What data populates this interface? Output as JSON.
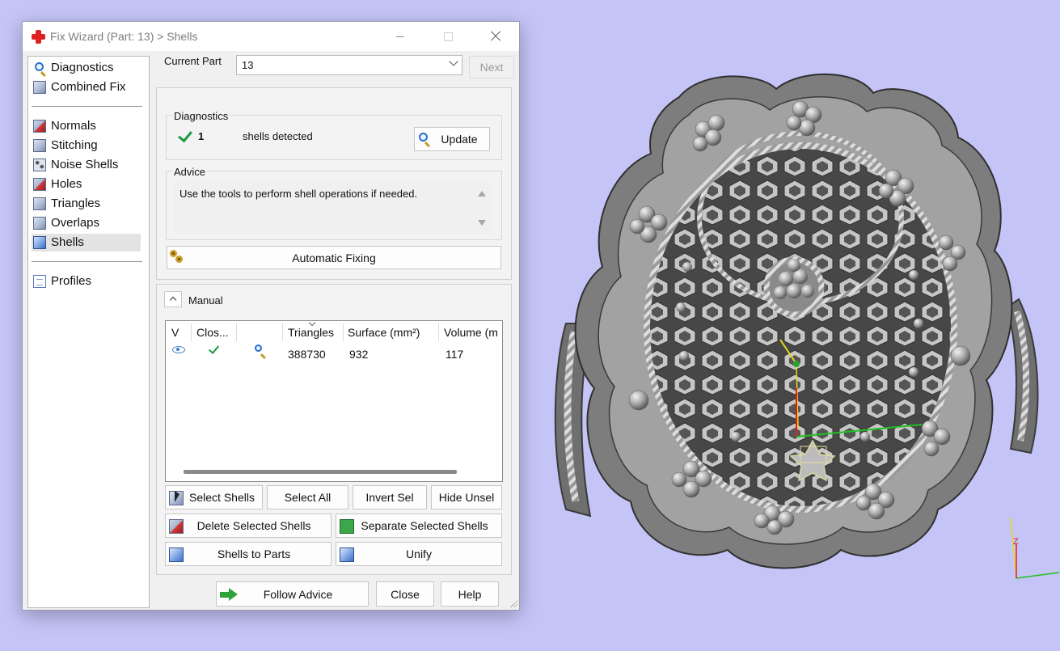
{
  "window": {
    "title": "Fix Wizard (Part: 13) > Shells"
  },
  "nav": {
    "items": [
      {
        "label": "Diagnostics",
        "icon": "magnifier-icon"
      },
      {
        "label": "Combined Fix",
        "icon": "cube-icon"
      },
      {
        "label": "Normals",
        "icon": "normals-icon"
      },
      {
        "label": "Stitching",
        "icon": "stitching-icon"
      },
      {
        "label": "Noise Shells",
        "icon": "noise-shells-icon"
      },
      {
        "label": "Holes",
        "icon": "holes-icon"
      },
      {
        "label": "Triangles",
        "icon": "triangles-icon"
      },
      {
        "label": "Overlaps",
        "icon": "overlaps-icon"
      },
      {
        "label": "Shells",
        "icon": "shells-icon"
      },
      {
        "label": "Profiles",
        "icon": "profiles-icon"
      }
    ],
    "selected": "Shells"
  },
  "part": {
    "label": "Current Part",
    "value": "13",
    "next_label": "Next"
  },
  "diagnostics": {
    "title": "Diagnostics",
    "count": "1",
    "text": "shells detected",
    "update_label": "Update"
  },
  "advice": {
    "title": "Advice",
    "text": "Use the tools to perform shell operations if needed."
  },
  "auto_fix_label": "Automatic Fixing",
  "manual": {
    "title": "Manual",
    "columns": [
      "V",
      "Clos...",
      "",
      "Triangles",
      "Surface (mm²)",
      "Volume (m"
    ],
    "rows": [
      {
        "triangles": "388730",
        "surface": "932",
        "volume": "117"
      }
    ]
  },
  "buttons": {
    "select_shells": "Select Shells",
    "select_all": "Select All",
    "invert_sel": "Invert Sel",
    "hide_unsel": "Hide Unsel",
    "delete_selected": "Delete Selected Shells",
    "separate_selected": "Separate Selected Shells",
    "shells_to_parts": "Shells to Parts",
    "unify": "Unify",
    "follow_advice": "Follow Advice",
    "close": "Close",
    "help": "Help"
  },
  "colors": {
    "background": "#c4c4f7",
    "model": "#7d7d7d",
    "check_green": "#1a9a45",
    "axis_x": "#20c020",
    "axis_y": "#e0d020",
    "axis_z": "#e02020"
  }
}
